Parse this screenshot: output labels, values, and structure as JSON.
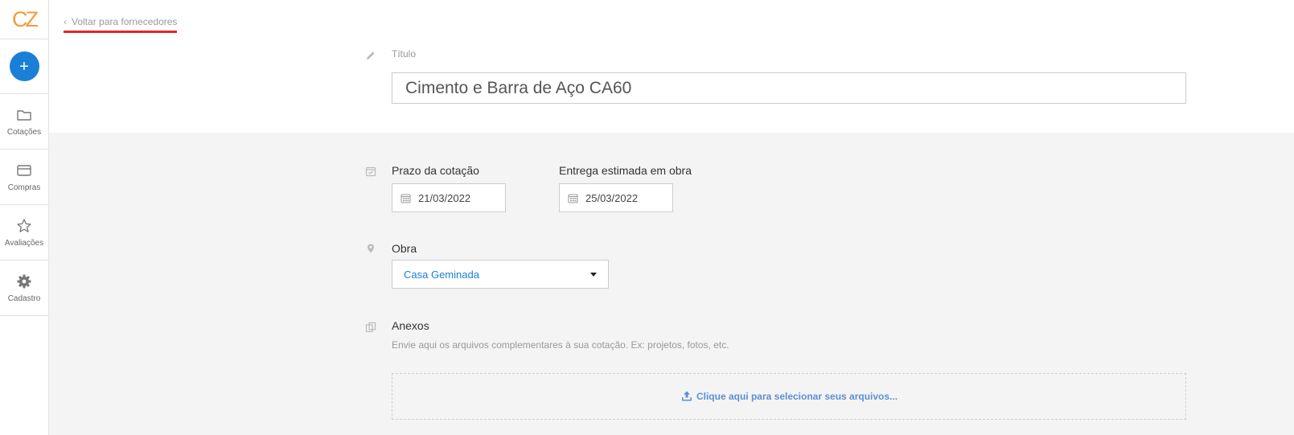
{
  "sidebar": {
    "logo": "CZ",
    "add_label": "+",
    "items": [
      {
        "label": "Cotações",
        "icon": "folder-icon"
      },
      {
        "label": "Compras",
        "icon": "card-icon"
      },
      {
        "label": "Avaliações",
        "icon": "star-icon"
      },
      {
        "label": "Cadastro",
        "icon": "gear-icon"
      }
    ]
  },
  "back_link": {
    "label": "Voltar para fornecedores"
  },
  "form": {
    "title_label": "Título",
    "title_value": "Cimento e Barra de Aço CA60",
    "deadline_label": "Prazo da cotação",
    "deadline_value": "21/03/2022",
    "delivery_label": "Entrega estimada em obra",
    "delivery_value": "25/03/2022",
    "site_label": "Obra",
    "site_value": "Casa Geminada",
    "attachments_label": "Anexos",
    "attachments_hint": "Envie aqui os arquivos complementares à sua cotação. Ex: projetos, fotos, etc.",
    "upload_label": "Clique aqui para selecionar seus arquivos..."
  },
  "colors": {
    "brand_orange": "#f39c35",
    "primary_blue": "#1a7fd6",
    "link_blue": "#5b8fd4",
    "underline_red": "#e0262b"
  }
}
